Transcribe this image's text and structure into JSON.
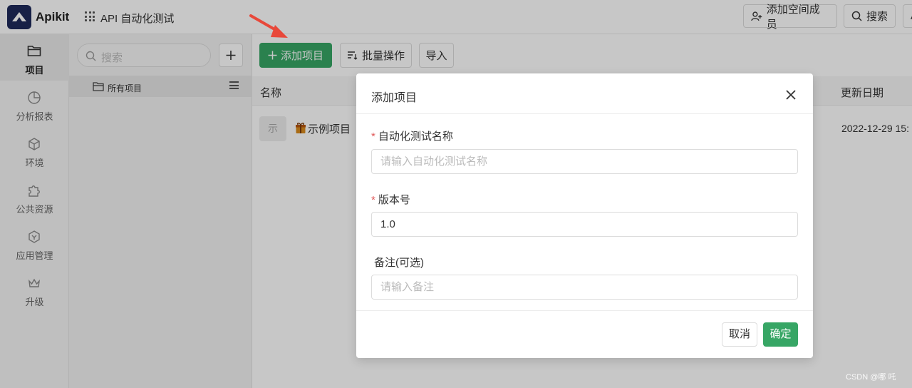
{
  "header": {
    "brand": "Apikit",
    "workspace": "API 自动化测试",
    "add_member": "添加空间成员",
    "search": "搜索",
    "more_label": "A"
  },
  "leftnav": {
    "items": [
      {
        "label": "项目",
        "icon": "folder-icon"
      },
      {
        "label": "分析报表",
        "icon": "pie-chart-icon"
      },
      {
        "label": "环境",
        "icon": "cube-icon"
      },
      {
        "label": "公共资源",
        "icon": "puzzle-icon"
      },
      {
        "label": "应用管理",
        "icon": "hexagon-icon"
      },
      {
        "label": "升级",
        "icon": "crown-icon"
      }
    ]
  },
  "panel": {
    "search_placeholder": "搜索",
    "all_projects": "所有项目"
  },
  "toolbar": {
    "add_project": "添加项目",
    "batch": "批量操作",
    "import": "导入"
  },
  "table": {
    "col_name": "名称",
    "col_updated": "更新日期",
    "rows": [
      {
        "badge": "示",
        "name": "示例项目",
        "updated": "2022-12-29 15:"
      }
    ]
  },
  "dialog": {
    "title": "添加项目",
    "fields": [
      {
        "label": "自动化测试名称",
        "required": "*",
        "value": "",
        "placeholder": "请输入自动化测试名称"
      },
      {
        "label": "版本号",
        "required": "*",
        "value": "1.0",
        "placeholder": ""
      },
      {
        "label": "备注(可选)",
        "required": "",
        "value": "",
        "placeholder": "请输入备注"
      }
    ],
    "cancel": "取消",
    "ok": "确定"
  },
  "watermark": "CSDN @哪 吒",
  "colors": {
    "accent": "#37a665",
    "brand_bg": "#1e2a5a",
    "required": "#e05a5a",
    "annotation_arrow": "#e8483a"
  }
}
